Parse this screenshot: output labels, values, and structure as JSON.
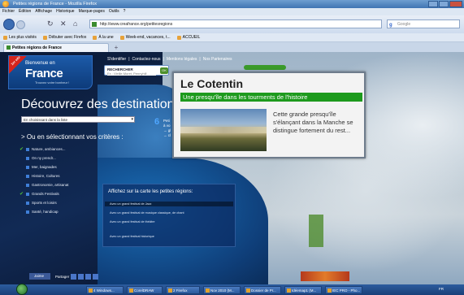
{
  "window": {
    "title": "Petites régions de France - Mozilla Firefox"
  },
  "menubar": [
    "Fichier",
    "Édition",
    "Affichage",
    "Historique",
    "Marque-pages",
    "Outils",
    "?"
  ],
  "navigation": {
    "url": "http://www.creafrance.org/petitesregions",
    "search_placeholder": "Google",
    "search_logo": "g"
  },
  "bookmarks": [
    "Les plus visités",
    "Débuter avec Firefox",
    "À la une",
    "Week-end, vacances, t...",
    "ACCUEIL"
  ],
  "tabs": [
    {
      "label": "Petites régions de France"
    }
  ],
  "site": {
    "logo": {
      "ribbon": "1er site",
      "top": "Bienvenue en",
      "name": "France",
      "tagline": "Trouvez votre bonheur !"
    },
    "toplinks": [
      "S'identifier",
      "|",
      "Contactez-nous",
      "|",
      "Mentions légales",
      "|",
      "Nos Partenaires"
    ],
    "search": {
      "label": "RECHERCHER",
      "placeholder": "Ex : Vieille Moret, Pennyhill",
      "button": "OK"
    },
    "heading": "Découvrez des destinations",
    "select_value": "En choisissant dans la liste",
    "criteria_heading": "> Ou en sélectionnant vos critères :",
    "count": "6",
    "count_sub": [
      "Peti",
      "à vo",
      "→ gl",
      "→ cl"
    ],
    "criteria": [
      {
        "label": "Nature, ambiances...",
        "checked": true
      },
      {
        "label": "On ny prendr...",
        "checked": false
      },
      {
        "label": "Mer, baignades",
        "checked": false
      },
      {
        "label": "Histoire, Cultures",
        "checked": false
      },
      {
        "label": "Gastronomie, artisanat",
        "checked": false
      },
      {
        "label": "Grands Festivals",
        "checked": true
      },
      {
        "label": "Sports et loisirs",
        "checked": false
      },
      {
        "label": "Santé, handicap",
        "checked": false
      }
    ],
    "map_panel": {
      "title": "Affichez sur la carte les petites régions:",
      "options": [
        "Avec un grand festival de Jazz",
        "Avec un grand festival de musique classique, de chant",
        "Avec un grand festival de théâtre",
        "Avec un grand festival historique"
      ]
    },
    "popup": {
      "title": "Le Cotentin",
      "subtitle": "Une presqu'île dans les tourments de l'histoire",
      "text": "Cette grande presqu'île s'élançant dans la Manche se distingue fortement du rest..."
    },
    "share": {
      "facebook": "Jaime",
      "label": "Partager"
    }
  },
  "taskbar": {
    "items": [
      "4 Windows...",
      "CorelDRAW",
      "2 Firefox",
      "Nov 2010 (M...",
      "Dossier de Pr...",
      "Idéemap1 (M...",
      "IEC PRO - Pho..."
    ],
    "clock": "FR"
  },
  "colors": {
    "accent_green": "#1d9a1d",
    "window_blue": "#3f74b3",
    "page_dark": "#0c1b38"
  }
}
